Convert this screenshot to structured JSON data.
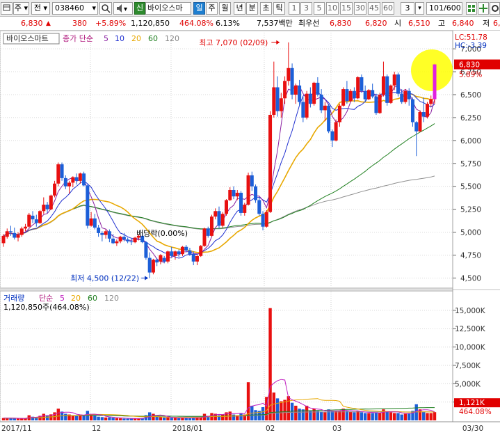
{
  "toolbar": {
    "menu_icon": "menu-icon",
    "type_label": "주",
    "prev_label": "전",
    "code": "038460",
    "search_icon": "search-icon",
    "sound_icon": "speaker-icon",
    "new_badge": "신",
    "stock_name": "바이오스마",
    "periods": [
      "일",
      "주",
      "월",
      "년",
      "분",
      "초",
      "틱"
    ],
    "active_period": "일",
    "intervals": [
      "1",
      "3",
      "5",
      "10",
      "15",
      "30",
      "45",
      "60"
    ],
    "custom_interval": "3",
    "page_counter": "101/600",
    "tool_icons": [
      "grid-icon",
      "crosshair-icon",
      "settings-icon"
    ]
  },
  "quote": {
    "price": "6,830",
    "direction_icon": "up-triangle-icon",
    "change": "380",
    "change_pct": "+5.89%",
    "volume": "1,120,850",
    "volume_ratio": "464.08%",
    "turnover_rate": "6.13%",
    "trade_value": "7,537백만",
    "best_label": "최우선",
    "ask": "6,830",
    "bid": "6,820",
    "open_label": "시",
    "open": "6,510",
    "high_label": "고",
    "high": "6,840",
    "low_label": "저",
    "low": "6,"
  },
  "price_panel": {
    "stock_tag": "바이오스마트",
    "ma_prefix": "종가 단순",
    "ma_periods": [
      {
        "label": "5",
        "color": "#8a1fa0"
      },
      {
        "label": "10",
        "color": "#2030d0"
      },
      {
        "label": "20",
        "color": "#e8a800"
      },
      {
        "label": "60",
        "color": "#208020"
      },
      {
        "label": "120",
        "color": "#909090"
      }
    ],
    "lc_label": "LC:51.78",
    "hc_label": "HC:-3.39",
    "current_price_tag": "6,830",
    "current_pct": "5.89%",
    "high_note": "최고 7,070 (02/09)",
    "low_note": "최저 4,500 (12/22)",
    "dividend_note": "배당락(0.00%)"
  },
  "volume_panel": {
    "title": "거래량",
    "ma_prefix": "단순",
    "ma_periods": [
      {
        "label": "5",
        "color": "#c020c0"
      },
      {
        "label": "20",
        "color": "#e8a800"
      },
      {
        "label": "60",
        "color": "#208020"
      },
      {
        "label": "120",
        "color": "#909090"
      }
    ],
    "summary": "1,120,850주(464.08%)",
    "current_tag": "1,121K",
    "ratio_tag": "464.08%"
  },
  "x_axis_labels": [
    "2017/11",
    "12",
    "2018/01",
    "02",
    "03",
    "03/30"
  ],
  "chart_data": {
    "type": "candlestick",
    "price_axis": {
      "ticks": [
        4500,
        4750,
        5000,
        5250,
        5500,
        5750,
        6000,
        6250,
        6500,
        6750,
        7000
      ],
      "ylim": [
        4420,
        7130
      ]
    },
    "volume_axis": {
      "ticks": [
        2500,
        5000,
        7500,
        10000,
        12500,
        15000
      ],
      "unit": "K",
      "ylim": [
        0,
        16600
      ]
    },
    "candles": [
      [
        4880,
        4980,
        4840,
        4960,
        320
      ],
      [
        4950,
        5040,
        4930,
        5010,
        300
      ],
      [
        5010,
        5070,
        4960,
        5000,
        290
      ],
      [
        4990,
        5050,
        4920,
        4940,
        270
      ],
      [
        4940,
        5000,
        4900,
        4970,
        250
      ],
      [
        4970,
        5060,
        4950,
        5040,
        280
      ],
      [
        5040,
        5090,
        5010,
        5060,
        260
      ],
      [
        5060,
        5210,
        5050,
        5190,
        700
      ],
      [
        5180,
        5230,
        5100,
        5140,
        500
      ],
      [
        5140,
        5190,
        5060,
        5100,
        430
      ],
      [
        5100,
        5240,
        5090,
        5230,
        620
      ],
      [
        5230,
        5380,
        5200,
        5300,
        900
      ],
      [
        5300,
        5330,
        5210,
        5250,
        700
      ],
      [
        5250,
        5410,
        5240,
        5400,
        820
      ],
      [
        5400,
        5560,
        5380,
        5530,
        1100
      ],
      [
        5530,
        5760,
        5500,
        5740,
        1600
      ],
      [
        5740,
        5760,
        5560,
        5590,
        1200
      ],
      [
        5590,
        5620,
        5470,
        5500,
        900
      ],
      [
        5500,
        5560,
        5420,
        5540,
        800
      ],
      [
        5540,
        5610,
        5490,
        5600,
        700
      ],
      [
        5600,
        5640,
        5520,
        5560,
        620
      ],
      [
        5560,
        5650,
        5530,
        5640,
        800
      ],
      [
        5640,
        5660,
        5500,
        5510,
        700
      ],
      [
        5510,
        5520,
        5040,
        5070,
        1300
      ],
      [
        5070,
        5220,
        5060,
        5150,
        800
      ],
      [
        5150,
        5200,
        5030,
        5050,
        650
      ],
      [
        5050,
        5080,
        4950,
        4990,
        500
      ],
      [
        4990,
        5010,
        4900,
        4970,
        450
      ],
      [
        4970,
        5030,
        4930,
        5010,
        400
      ],
      [
        5010,
        5030,
        4890,
        4930,
        420
      ],
      [
        4930,
        4980,
        4870,
        4880,
        360
      ],
      [
        4880,
        4920,
        4850,
        4900,
        300
      ],
      [
        4900,
        4960,
        4880,
        4950,
        280
      ],
      [
        4950,
        4990,
        4900,
        4920,
        250
      ],
      [
        4920,
        4940,
        4880,
        4900,
        230
      ],
      [
        4900,
        4930,
        4860,
        4890,
        240
      ],
      [
        4890,
        4950,
        4880,
        4940,
        260
      ],
      [
        4940,
        4980,
        4910,
        4960,
        250
      ],
      [
        4960,
        4990,
        4880,
        4890,
        300
      ],
      [
        4890,
        4900,
        4700,
        4720,
        700
      ],
      [
        4720,
        4780,
        4500,
        4560,
        1100
      ],
      [
        4560,
        4710,
        4540,
        4700,
        900
      ],
      [
        4700,
        4720,
        4630,
        4670,
        500
      ],
      [
        4680,
        4760,
        4650,
        4750,
        450
      ],
      [
        4720,
        4740,
        4660,
        4680,
        380
      ],
      [
        4680,
        4800,
        4660,
        4790,
        400
      ],
      [
        4790,
        4840,
        4720,
        4740,
        350
      ],
      [
        4740,
        4800,
        4700,
        4790,
        330
      ],
      [
        4790,
        4810,
        4730,
        4760,
        300
      ],
      [
        4760,
        4850,
        4740,
        4840,
        350
      ],
      [
        4840,
        4860,
        4780,
        4800,
        320
      ],
      [
        4800,
        4830,
        4740,
        4760,
        300
      ],
      [
        4760,
        4790,
        4640,
        4680,
        400
      ],
      [
        4680,
        4750,
        4640,
        4740,
        380
      ],
      [
        4740,
        4860,
        4730,
        4850,
        420
      ],
      [
        4850,
        5050,
        4840,
        5040,
        900
      ],
      [
        5040,
        5060,
        4940,
        4960,
        600
      ],
      [
        4960,
        5190,
        4950,
        5170,
        1000
      ],
      [
        5170,
        5260,
        5140,
        5230,
        900
      ],
      [
        5230,
        5280,
        5040,
        5070,
        700
      ],
      [
        5070,
        5220,
        5050,
        5200,
        800
      ],
      [
        5200,
        5360,
        5180,
        5350,
        1100
      ],
      [
        5350,
        5490,
        5340,
        5460,
        1200
      ],
      [
        5460,
        5500,
        5360,
        5390,
        800
      ],
      [
        5390,
        5460,
        5350,
        5430,
        700
      ],
      [
        5430,
        5450,
        5180,
        5210,
        1000
      ],
      [
        5210,
        5320,
        5180,
        5300,
        800
      ],
      [
        5300,
        5650,
        5290,
        5620,
        5200
      ],
      [
        5620,
        5660,
        5450,
        5500,
        2000
      ],
      [
        5500,
        5520,
        5320,
        5350,
        1400
      ],
      [
        5350,
        5380,
        5180,
        5200,
        1300
      ],
      [
        5200,
        5230,
        5020,
        5060,
        1800
      ],
      [
        5060,
        5240,
        5050,
        5220,
        3200
      ],
      [
        5220,
        6320,
        5210,
        6280,
        15300
      ],
      [
        6280,
        6860,
        6250,
        6580,
        3800
      ],
      [
        6580,
        6700,
        6260,
        6320,
        3000
      ],
      [
        6320,
        6520,
        6250,
        6460,
        2600
      ],
      [
        6460,
        6700,
        6400,
        6650,
        2800
      ],
      [
        6650,
        7070,
        6600,
        6790,
        3300
      ],
      [
        6790,
        6840,
        6450,
        6500,
        2400
      ],
      [
        6500,
        6620,
        6400,
        6600,
        2000
      ],
      [
        6600,
        6660,
        6380,
        6420,
        1600
      ],
      [
        6420,
        6480,
        6200,
        6250,
        1500
      ],
      [
        6250,
        6540,
        6230,
        6510,
        2000
      ],
      [
        6510,
        6580,
        6360,
        6400,
        1300
      ],
      [
        6400,
        6640,
        6380,
        6630,
        1600
      ],
      [
        6630,
        6690,
        6480,
        6500,
        1300
      ],
      [
        6500,
        6560,
        6300,
        6330,
        1200
      ],
      [
        6330,
        6420,
        6210,
        6380,
        1100
      ],
      [
        6380,
        6400,
        6080,
        6100,
        1500
      ],
      [
        6100,
        6120,
        5930,
        6000,
        1300
      ],
      [
        6000,
        6230,
        5990,
        6200,
        1300
      ],
      [
        6200,
        6400,
        6150,
        6380,
        1300
      ],
      [
        6380,
        6580,
        6370,
        6560,
        1600
      ],
      [
        6560,
        6650,
        6400,
        6430,
        1300
      ],
      [
        6430,
        6560,
        6420,
        6540,
        1200
      ],
      [
        6540,
        6580,
        6420,
        6460,
        1100
      ],
      [
        6460,
        6700,
        6450,
        6690,
        1300
      ],
      [
        6690,
        6720,
        6520,
        6540,
        1100
      ],
      [
        6540,
        6600,
        6420,
        6450,
        1000
      ],
      [
        6450,
        6560,
        6440,
        6550,
        1000
      ],
      [
        6550,
        6620,
        6460,
        6480,
        1000
      ],
      [
        6480,
        6510,
        6280,
        6300,
        1100
      ],
      [
        6300,
        6520,
        6290,
        6500,
        1000
      ],
      [
        6500,
        6860,
        6480,
        6700,
        1500
      ],
      [
        6700,
        6720,
        6380,
        6410,
        1200
      ],
      [
        6410,
        6610,
        6400,
        6600,
        1100
      ],
      [
        6600,
        6750,
        6550,
        6720,
        1000
      ],
      [
        6720,
        6740,
        6480,
        6510,
        1000
      ],
      [
        6510,
        6560,
        6400,
        6420,
        800
      ],
      [
        6420,
        6560,
        6400,
        6540,
        900
      ],
      [
        6540,
        6570,
        6380,
        6450,
        1000
      ],
      [
        6450,
        6470,
        6150,
        6200,
        1300
      ],
      [
        6200,
        6210,
        5830,
        6100,
        2200
      ],
      [
        6100,
        6330,
        6090,
        6310,
        1500
      ],
      [
        6310,
        6470,
        6200,
        6260,
        1200
      ],
      [
        6260,
        6420,
        6240,
        6400,
        1000
      ],
      [
        6400,
        6490,
        6370,
        6450,
        1000
      ],
      [
        6450,
        6840,
        6400,
        6830,
        1121
      ]
    ],
    "candle_fields": [
      "open",
      "high",
      "low",
      "close",
      "volume_k"
    ]
  }
}
